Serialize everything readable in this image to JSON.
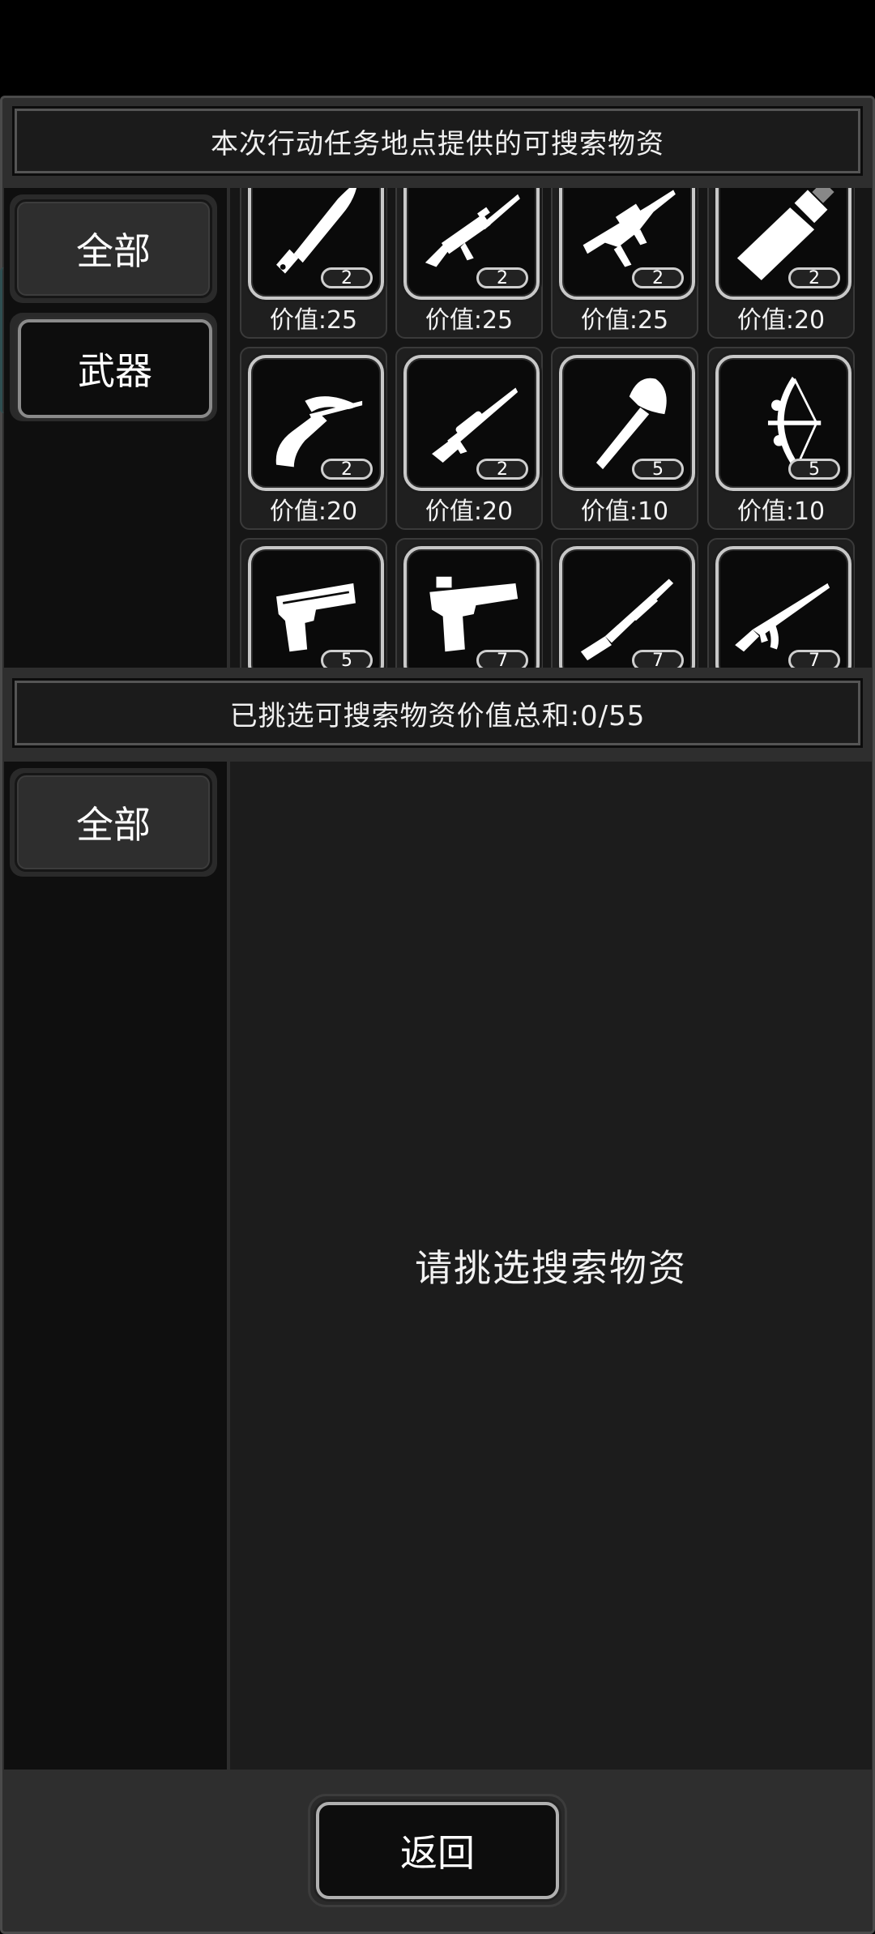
{
  "header": {
    "title": "本次行动任务地点提供的可搜索物资"
  },
  "top_sidebar": {
    "tabs": [
      {
        "label": "全部"
      },
      {
        "label": "武器"
      }
    ]
  },
  "items": [
    {
      "icon": "knife-icon",
      "count": "2",
      "value": "价值:25"
    },
    {
      "icon": "assault-rifle-icon",
      "count": "2",
      "value": "价值:25"
    },
    {
      "icon": "bullpup-rifle-icon",
      "count": "2",
      "value": "价值:25"
    },
    {
      "icon": "broad-blade-icon",
      "count": "2",
      "value": "价值:20"
    },
    {
      "icon": "crossbow-icon",
      "count": "2",
      "value": "价值:20"
    },
    {
      "icon": "sniper-rifle-icon",
      "count": "2",
      "value": "价值:20"
    },
    {
      "icon": "axe-icon",
      "count": "5",
      "value": "价值:10"
    },
    {
      "icon": "compound-bow-icon",
      "count": "5",
      "value": "价值:10"
    },
    {
      "icon": "pistol-icon",
      "count": "5",
      "value": ""
    },
    {
      "icon": "desert-eagle-icon",
      "count": "7",
      "value": ""
    },
    {
      "icon": "shotgun-icon",
      "count": "7",
      "value": ""
    },
    {
      "icon": "ak-rifle-icon",
      "count": "7",
      "value": ""
    }
  ],
  "summary": {
    "text": "已挑选可搜索物资价值总和:0/55"
  },
  "bottom_sidebar": {
    "tabs": [
      {
        "label": "全部"
      }
    ]
  },
  "selected": {
    "empty_message": "请挑选搜索物资"
  },
  "footer": {
    "back_label": "返回"
  }
}
